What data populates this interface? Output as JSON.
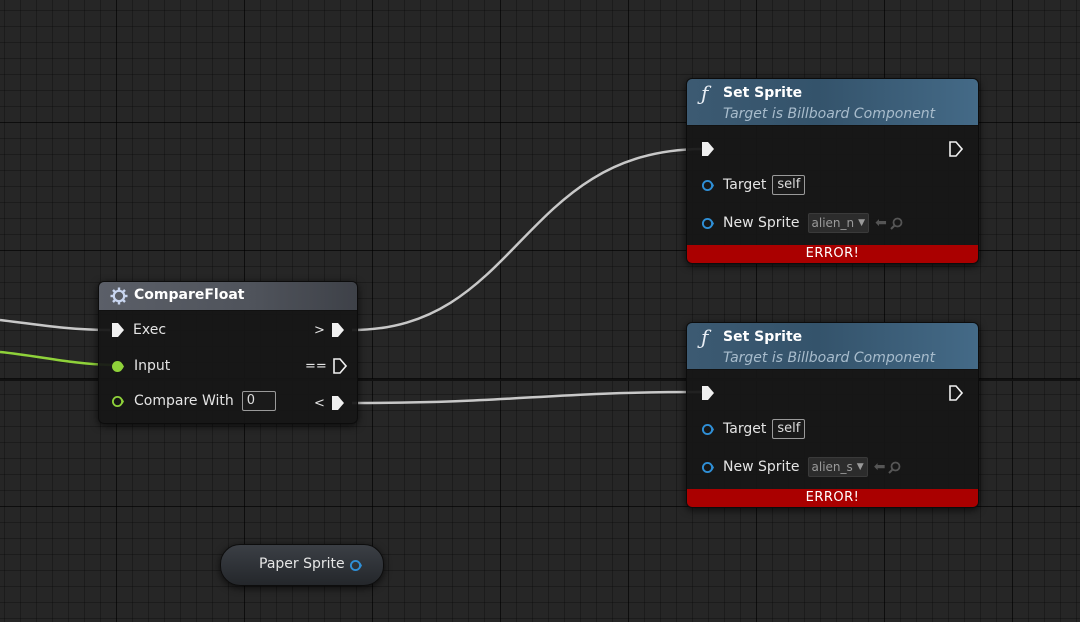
{
  "compare_float": {
    "title": "CompareFloat",
    "icon": "gear-icon",
    "inputs": {
      "exec": "Exec",
      "input": "Input",
      "compare_with": "Compare With"
    },
    "compare_with_value": "0",
    "outputs": {
      "greater": ">",
      "equal": "==",
      "less": "<"
    }
  },
  "set_sprite_1": {
    "title": "Set Sprite",
    "subtitle": "Target is Billboard Component",
    "target_label": "Target",
    "target_value": "self",
    "new_sprite_label": "New Sprite",
    "new_sprite_value": "alien_n",
    "error": "ERROR!"
  },
  "set_sprite_2": {
    "title": "Set Sprite",
    "subtitle": "Target is Billboard Component",
    "target_label": "Target",
    "target_value": "self",
    "new_sprite_label": "New Sprite",
    "new_sprite_value": "alien_s",
    "error": "ERROR!"
  },
  "paper_sprite_var": {
    "label": "Paper Sprite"
  },
  "colors": {
    "exec_wire": "#c8c8c8",
    "float_wire": "#8fd23a",
    "object_pin": "#2f8fd6",
    "error": "#aa0000",
    "function_header": "#3c5a72"
  }
}
